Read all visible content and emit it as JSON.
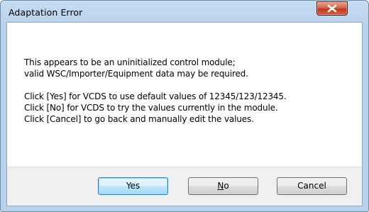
{
  "window": {
    "title": "Adaptation Error",
    "close_glyph": "x",
    "close_icon": "close-icon"
  },
  "message": {
    "paragraph1": [
      "This appears to be an uninitialized control module;",
      "valid WSC/Importer/Equipment data may be required."
    ],
    "paragraph2": [
      "Click [Yes] for VCDS to use default values of 12345/123/12345.",
      "Click [No] for VCDS to try the values currently in the module.",
      "Click [Cancel] to go back and manually edit the values."
    ]
  },
  "buttons": {
    "yes": "Yes",
    "no_mnemonic": "N",
    "no_rest": "o",
    "cancel": "Cancel"
  },
  "colors": {
    "titlebar": "#b9d1ea",
    "close_button": "#c0361f",
    "button_bar": "#f0f0f0",
    "default_button_border": "#3c7fb1"
  }
}
